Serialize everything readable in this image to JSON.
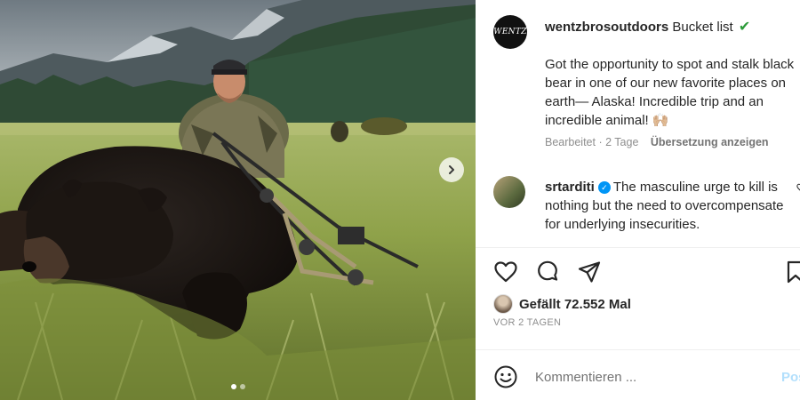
{
  "post": {
    "photo_alt": "",
    "carousel": {
      "dot_count": 2,
      "active_index": 1
    },
    "caption": {
      "avatar_text": "WENTZ",
      "username": "wentzbrosoutdoors",
      "headline": "Bucket list",
      "check_emoji": "✔",
      "body": "Got the opportunity to spot and stalk black bear in one of our new favorite places on earth— Alaska! Incredible trip and an incredible animal! 🙌🏼",
      "edited": "Bearbeitet · 2 Tage",
      "translate": "Übersetzung anzeigen"
    },
    "comment": {
      "username": "srtarditi",
      "verified": true,
      "text": "The masculine urge to kill is nothing but the need to overcompensate for underlying insecurities."
    },
    "likes": "Gefällt 72.552 Mal",
    "time": "VOR 2 TAGEN",
    "composer": {
      "placeholder": "Kommentieren ...",
      "post_label": "Posten"
    },
    "icons": {
      "like": "heart-icon",
      "comment": "comment-bubble-icon",
      "share": "paper-plane-icon",
      "save": "bookmark-icon",
      "emoji": "smiley-icon",
      "next": "chevron-right-icon"
    },
    "colors": {
      "post_button": "#b2dffc",
      "verified": "#0095f6",
      "muted_text": "#8e8e8e"
    }
  }
}
